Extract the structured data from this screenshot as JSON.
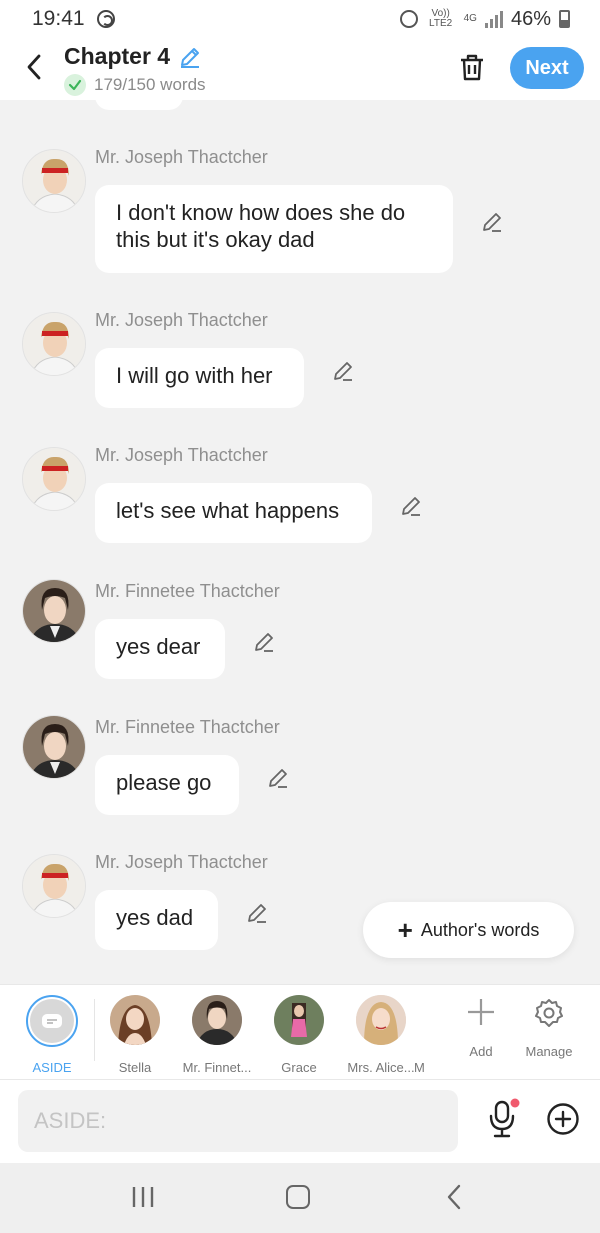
{
  "status_bar": {
    "time": "19:41",
    "volte": "Vo)) LTE2",
    "network": "4G",
    "battery": "46%"
  },
  "header": {
    "title": "Chapter 4",
    "word_count": "179/150 words",
    "next_label": "Next"
  },
  "messages": [
    {
      "sender": "Mr. Joseph Thactcher",
      "text": "I don't know how does she do this but it's okay dad"
    },
    {
      "sender": "Mr. Joseph Thactcher",
      "text": "I will go with her"
    },
    {
      "sender": "Mr. Joseph Thactcher",
      "text": "let's see what happens"
    },
    {
      "sender": "Mr. Finnetee Thactcher",
      "text": "yes dear"
    },
    {
      "sender": "Mr. Finnetee Thactcher",
      "text": "please go"
    },
    {
      "sender": "Mr. Joseph Thactcher",
      "text": "yes dad"
    }
  ],
  "authors_words": {
    "label": "Author's words"
  },
  "characters": [
    {
      "label": "ASIDE"
    },
    {
      "label": "Stella"
    },
    {
      "label": "Mr. Finnet..."
    },
    {
      "label": "Grace"
    },
    {
      "label": "Mrs. Alice..."
    },
    {
      "label": "M"
    }
  ],
  "tools": {
    "add_label": "Add",
    "manage_label": "Manage"
  },
  "input": {
    "placeholder": "ASIDE:"
  },
  "colors": {
    "accent": "#4aa3f0",
    "mic_dot": "#f05a6e",
    "check": "#3cb55a"
  }
}
